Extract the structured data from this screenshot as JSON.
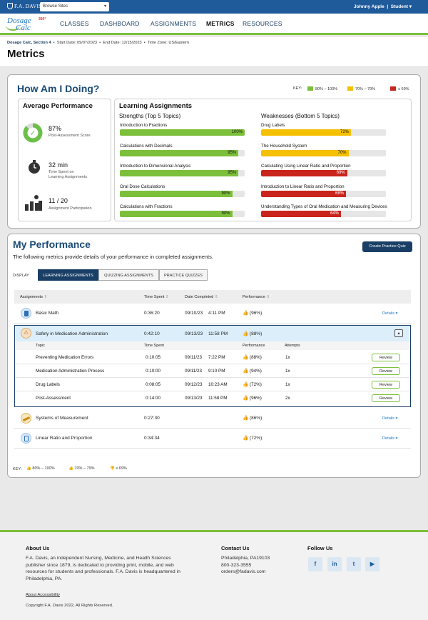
{
  "topbar": {
    "brand": "F.A. DAVIS",
    "browse_label": "Browse Sites",
    "user_name": "Johnny Apple",
    "user_role": "Student"
  },
  "logo": {
    "line1": "Dosage",
    "line2": "Calc",
    "badge": "360°"
  },
  "nav": [
    {
      "label": "CLASSES",
      "active": false
    },
    {
      "label": "DASHBOARD",
      "active": false
    },
    {
      "label": "ASSIGNMENTS",
      "active": false
    },
    {
      "label": "METRICS",
      "active": true
    },
    {
      "label": "RESOURCES",
      "active": false
    }
  ],
  "course": {
    "name": "Dosage Calc, Section 4",
    "start": "Start Date: 09/07/2023",
    "end": "End Date: 12/15/2023",
    "timezone": "Time Zone: US/Eastern"
  },
  "page_title": "Metrics",
  "how": {
    "title": "How Am I Doing?",
    "key_label": "KEY:",
    "key": [
      {
        "label": "80% – 100%",
        "color": "#7cbf3a"
      },
      {
        "label": "70% – 79%",
        "color": "#f5c000"
      },
      {
        "label": "≤ 69%",
        "color": "#c9251c"
      }
    ],
    "avg": {
      "title": "Average Performance",
      "post_value": "87%",
      "post_label": "Post-Assessment Score",
      "post_pct": 87,
      "time_value": "32 min",
      "time_label1": "Time Spent on",
      "time_label2": "Learning Assignments",
      "part_value": "11 / 20",
      "part_label": "Assignment Participation"
    },
    "learning": {
      "title": "Learning Assignments",
      "strengths_title": "Strengths (Top 5 Topics)",
      "weaknesses_title": "Weaknesses (Bottom 5 Topics)",
      "strengths": [
        {
          "label": "Introduction to Fractions",
          "pct": 100,
          "text": "100%"
        },
        {
          "label": "Calculations with Decimals",
          "pct": 95,
          "text": "95%"
        },
        {
          "label": "Introduction to Dimensional Analysis",
          "pct": 95,
          "text": "95%"
        },
        {
          "label": "Oral Dose Calculations",
          "pct": 90,
          "text": "90%"
        },
        {
          "label": "Calculations with Fractions",
          "pct": 90,
          "text": "90%"
        }
      ],
      "weaknesses": [
        {
          "label": "Drug Labels",
          "pct": 72,
          "text": "72%"
        },
        {
          "label": "The Household System",
          "pct": 70,
          "text": "70%"
        },
        {
          "label": "Calculating Using Linear Ratio and Proportion",
          "pct": 69,
          "text": "69%"
        },
        {
          "label": "Introduction to Linear Ratio and Proportion",
          "pct": 68,
          "text": "68%"
        },
        {
          "label": "Understanding Types of Oral Medication and Measuring Devices",
          "pct": 64,
          "text": "64%"
        }
      ]
    }
  },
  "perf": {
    "title": "My Performance",
    "description": "The following metrics provide details of your performance in completed assignments.",
    "practice_button": "Create Practice Quiz",
    "display_label": "DISPLAY",
    "tabs": [
      "LEARNING ASSIGNMENTS",
      "QUIZZING ASSIGNMENTS",
      "PRACTICE QUIZZES"
    ],
    "columns": [
      "Assignments",
      "Time Spent",
      "Date Completed",
      "Performance"
    ],
    "rows": [
      {
        "name": "Basic Math",
        "time": "0:36:20",
        "date": "09/10/23",
        "clock": "4:11 PM",
        "perf": "(96%)",
        "action": "Details"
      },
      {
        "name": "Safety in Medication Administration",
        "time": "0:42:10",
        "date": "09/13/23",
        "clock": "11:58 PM",
        "perf": "(88%)",
        "action": ""
      },
      {
        "name": "Systems of Measurement",
        "time": "0:27:30",
        "date": "",
        "clock": "",
        "perf": "(86%)",
        "action": "Details"
      },
      {
        "name": "Linear Ratio and Proportion",
        "time": "0:34:34",
        "date": "",
        "clock": "",
        "perf": "(72%)",
        "action": "Details"
      }
    ],
    "sub_columns": [
      "Topic",
      "Time Spent",
      "Performance",
      "Attempts"
    ],
    "sub_rows": [
      {
        "topic": "Preventing Medication Errors",
        "time": "0:10:05",
        "date": "09/11/23",
        "clock": "7:22 PM",
        "perf": "(88%)",
        "attempts": "1x",
        "action": "Review"
      },
      {
        "topic": "Medication Administration Process",
        "time": "0:10:00",
        "date": "09/11/23",
        "clock": "9:10 PM",
        "perf": "(94%)",
        "attempts": "1x",
        "action": "Review"
      },
      {
        "topic": "Drug Labels",
        "time": "0:08:05",
        "date": "09/12/23",
        "clock": "10:23 AM",
        "perf": "(72%)",
        "attempts": "1x",
        "action": "Review"
      },
      {
        "topic": "Post-Assessment",
        "time": "0:14:00",
        "date": "09/13/23",
        "clock": "11:58 PM",
        "perf": "(96%)",
        "attempts": "2x",
        "action": "Review"
      }
    ],
    "key_label": "KEY:",
    "key": [
      "80% – 100%",
      "70% – 79%",
      "≤ 69%"
    ]
  },
  "footer": {
    "about_title": "About Us",
    "about_lines": [
      "F.A. Davis, an independent Nursing, Medicine, and Health Sciences",
      "publisher since 1879, is dedicated to providing print, mobile, and web",
      "resources for students and professionals. F.A. Davis is headquartered in",
      "Philadelphia, PA."
    ],
    "accessibility": "About Accessibility",
    "copyright": "Copyright F.A. Davis 2022, All Rights Reserved.",
    "contact_title": "Contact Us",
    "contact_lines": [
      "Philadelphia, PA19103",
      "800-323-3555",
      "orders@fadavis.com"
    ],
    "follow_title": "Follow Us",
    "social": [
      "f",
      "in",
      "t",
      "yt"
    ]
  }
}
